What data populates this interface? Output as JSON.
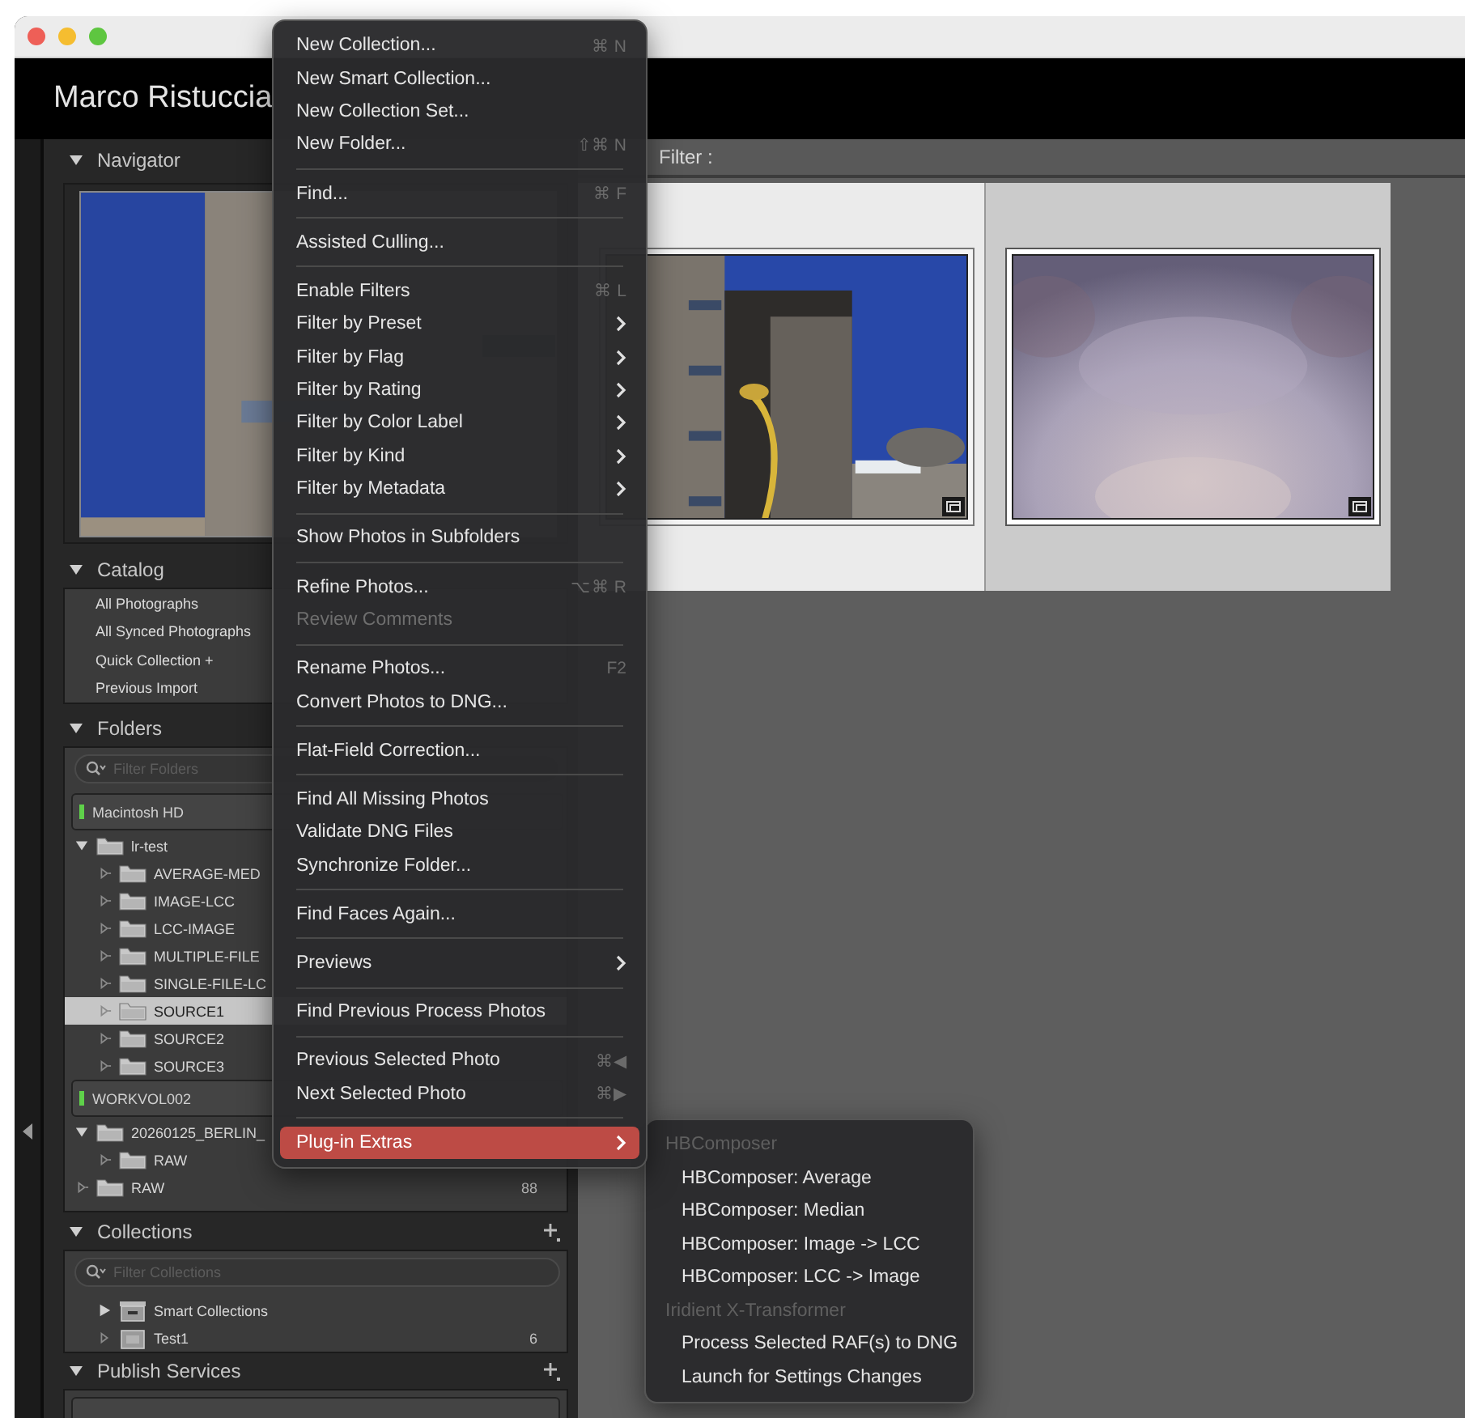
{
  "identity_plate": "Marco Ristuccia",
  "navigator": {
    "title": "Navigator"
  },
  "catalog": {
    "title": "Catalog",
    "items": [
      {
        "label": "All Photographs"
      },
      {
        "label": "All Synced Photographs"
      },
      {
        "label": "Quick Collection +"
      },
      {
        "label": "Previous Import"
      }
    ]
  },
  "folders": {
    "title": "Folders",
    "filter_placeholder": "Filter Folders",
    "volumes": [
      {
        "name": "Macintosh HD",
        "children": [
          {
            "name": "lr-test",
            "expanded": true,
            "selected": false,
            "children": [
              {
                "name": "AVERAGE-MED",
                "expanded": false,
                "selected": false
              },
              {
                "name": "IMAGE-LCC",
                "expanded": false,
                "selected": false
              },
              {
                "name": "LCC-IMAGE",
                "expanded": false,
                "selected": false
              },
              {
                "name": "MULTIPLE-FILE",
                "expanded": false,
                "selected": false
              },
              {
                "name": "SINGLE-FILE-LC",
                "expanded": false,
                "selected": false
              },
              {
                "name": "SOURCE1",
                "expanded": false,
                "selected": true
              },
              {
                "name": "SOURCE2",
                "expanded": false,
                "selected": false
              },
              {
                "name": "SOURCE3",
                "expanded": false,
                "selected": false
              }
            ]
          }
        ]
      },
      {
        "name": "WORKVOL002",
        "children": [
          {
            "name": "20260125_BERLIN_",
            "expanded": true,
            "selected": false,
            "children": [
              {
                "name": "RAW",
                "expanded": false,
                "selected": false
              }
            ]
          },
          {
            "name": "RAW",
            "count": "88",
            "expanded": false,
            "selected": false
          }
        ]
      }
    ]
  },
  "collections": {
    "title": "Collections",
    "filter_placeholder": "Filter Collections",
    "items": [
      {
        "kind": "smart-set",
        "name": "Smart Collections",
        "expanded": false
      },
      {
        "kind": "collection",
        "name": "Test1",
        "count": "6"
      }
    ]
  },
  "publish_services": {
    "title": "Publish Services"
  },
  "library_filter": {
    "label": "Filter :"
  },
  "grid": {
    "cells": [
      {
        "selected": true
      },
      {
        "selected": false
      }
    ]
  },
  "menu": {
    "items": [
      {
        "kind": "item",
        "label": "New Collection...",
        "shortcut": "⌘ N",
        "selected": false,
        "disabled": false
      },
      {
        "kind": "item",
        "label": "New Smart Collection...",
        "selected": false,
        "disabled": false
      },
      {
        "kind": "item",
        "label": "New Collection Set...",
        "selected": false,
        "disabled": false
      },
      {
        "kind": "item",
        "label": "New Folder...",
        "shortcut": "⇧⌘ N",
        "selected": false,
        "disabled": false
      },
      {
        "kind": "separator"
      },
      {
        "kind": "item",
        "label": "Find...",
        "shortcut": "⌘ F",
        "selected": false,
        "disabled": false
      },
      {
        "kind": "separator"
      },
      {
        "kind": "item",
        "label": "Assisted Culling...",
        "selected": false,
        "disabled": false
      },
      {
        "kind": "separator"
      },
      {
        "kind": "item",
        "label": "Enable Filters",
        "shortcut": "⌘ L",
        "selected": false,
        "disabled": false
      },
      {
        "kind": "item",
        "label": "Filter by Preset",
        "submenu": true,
        "selected": false,
        "disabled": false
      },
      {
        "kind": "item",
        "label": "Filter by Flag",
        "submenu": true,
        "selected": false,
        "disabled": false
      },
      {
        "kind": "item",
        "label": "Filter by Rating",
        "submenu": true,
        "selected": false,
        "disabled": false
      },
      {
        "kind": "item",
        "label": "Filter by Color Label",
        "submenu": true,
        "selected": false,
        "disabled": false
      },
      {
        "kind": "item",
        "label": "Filter by Kind",
        "submenu": true,
        "selected": false,
        "disabled": false
      },
      {
        "kind": "item",
        "label": "Filter by Metadata",
        "submenu": true,
        "selected": false,
        "disabled": false
      },
      {
        "kind": "separator"
      },
      {
        "kind": "item",
        "label": "Show Photos in Subfolders",
        "selected": false,
        "disabled": false
      },
      {
        "kind": "separator"
      },
      {
        "kind": "item",
        "label": "Refine Photos...",
        "shortcut": "⌥⌘ R",
        "selected": false,
        "disabled": false
      },
      {
        "kind": "item",
        "label": "Review Comments",
        "selected": false,
        "disabled": true
      },
      {
        "kind": "separator"
      },
      {
        "kind": "item",
        "label": "Rename Photos...",
        "shortcut": "F2",
        "selected": false,
        "disabled": false
      },
      {
        "kind": "item",
        "label": "Convert Photos to DNG...",
        "selected": false,
        "disabled": false
      },
      {
        "kind": "separator"
      },
      {
        "kind": "item",
        "label": "Flat-Field Correction...",
        "selected": false,
        "disabled": false
      },
      {
        "kind": "separator"
      },
      {
        "kind": "item",
        "label": "Find All Missing Photos",
        "selected": false,
        "disabled": false
      },
      {
        "kind": "item",
        "label": "Validate DNG Files",
        "selected": false,
        "disabled": false
      },
      {
        "kind": "item",
        "label": "Synchronize Folder...",
        "selected": false,
        "disabled": false
      },
      {
        "kind": "separator"
      },
      {
        "kind": "item",
        "label": "Find Faces Again...",
        "selected": false,
        "disabled": false
      },
      {
        "kind": "separator"
      },
      {
        "kind": "item",
        "label": "Previews",
        "submenu": true,
        "selected": false,
        "disabled": false
      },
      {
        "kind": "separator"
      },
      {
        "kind": "item",
        "label": "Find Previous Process Photos",
        "selected": false,
        "disabled": false
      },
      {
        "kind": "separator"
      },
      {
        "kind": "item",
        "label": "Previous Selected Photo",
        "shortcut": "⌘◀",
        "selected": false,
        "disabled": false
      },
      {
        "kind": "item",
        "label": "Next Selected Photo",
        "shortcut": "⌘▶",
        "selected": false,
        "disabled": false
      },
      {
        "kind": "separator"
      },
      {
        "kind": "item",
        "label": "Plug-in Extras",
        "submenu": true,
        "selected": true,
        "disabled": false
      }
    ]
  },
  "submenu": {
    "items": [
      {
        "kind": "header",
        "label": "HBComposer"
      },
      {
        "kind": "item",
        "label": "HBComposer: Average"
      },
      {
        "kind": "item",
        "label": "HBComposer: Median"
      },
      {
        "kind": "item",
        "label": "HBComposer: Image -> LCC"
      },
      {
        "kind": "item",
        "label": "HBComposer: LCC -> Image"
      },
      {
        "kind": "header",
        "label": "Iridient X-Transformer"
      },
      {
        "kind": "item",
        "label": "Process Selected RAF(s) to DNG"
      },
      {
        "kind": "item",
        "label": "Launch for Settings Changes"
      }
    ]
  }
}
